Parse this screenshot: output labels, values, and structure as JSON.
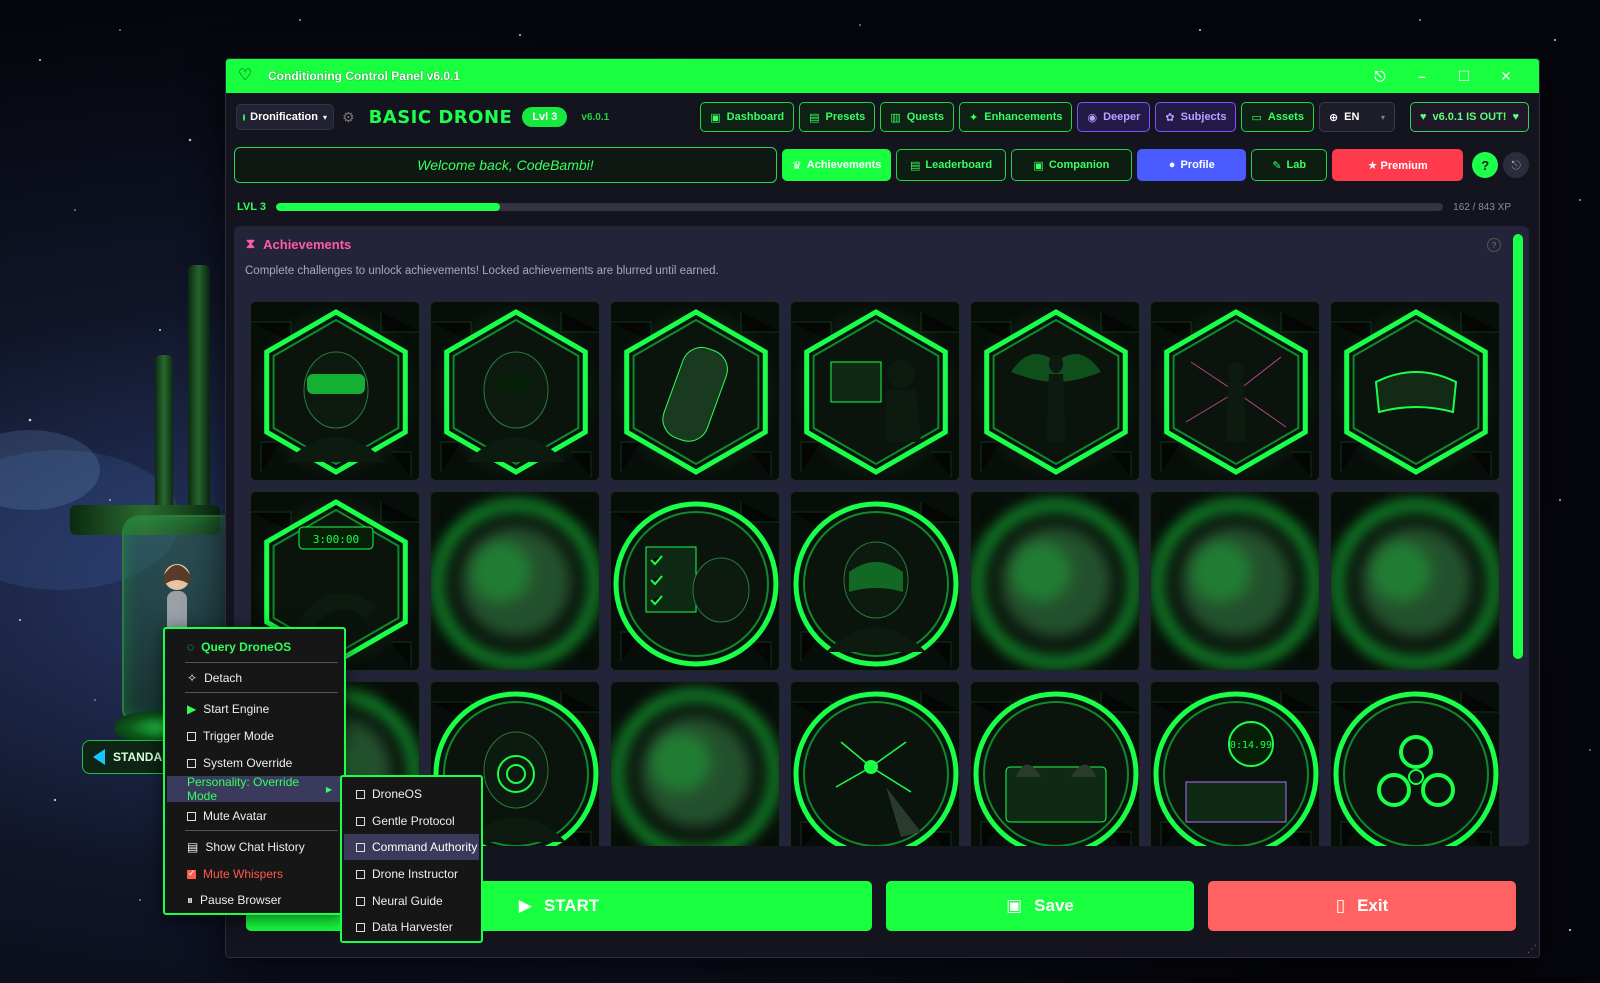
{
  "window": {
    "title": "Conditioning Control Panel v6.0.1",
    "controls": [
      "⎋",
      "–",
      "☐",
      "✕"
    ]
  },
  "toolbar": {
    "mode_value": "Dronification",
    "drone_title": "BASIC DRONE",
    "level_pill": "Lvl 3",
    "version_small": "v6.0.1",
    "nav": [
      {
        "label": "Dashboard",
        "icon": "dashboard-icon",
        "style": "green"
      },
      {
        "label": "Presets",
        "icon": "presets-icon",
        "style": "green"
      },
      {
        "label": "Quests",
        "icon": "quests-icon",
        "style": "green"
      },
      {
        "label": "Enhancements",
        "icon": "enhancements-icon",
        "style": "green"
      },
      {
        "label": "Deeper",
        "icon": "deeper-icon",
        "style": "purple"
      },
      {
        "label": "Subjects",
        "icon": "subjects-icon",
        "style": "purple"
      },
      {
        "label": "Assets",
        "icon": "folder-icon",
        "style": "green"
      }
    ],
    "language": "EN",
    "update_label": "v6.0.1 IS OUT!"
  },
  "row2": {
    "welcome": "Welcome back, CodeBambi!",
    "tabs": [
      {
        "label": "Achievements",
        "style": "active"
      },
      {
        "label": "Leaderboard",
        "style": "green"
      },
      {
        "label": "Companion",
        "style": "green"
      },
      {
        "label": "Profile",
        "style": "profile"
      },
      {
        "label": "Lab",
        "style": "green"
      },
      {
        "label": "★ Premium",
        "style": "premium"
      }
    ],
    "help": "?"
  },
  "xp": {
    "label": "LVL 3",
    "text": "162 / 843 XP",
    "progress": 0.192
  },
  "achievements": {
    "title": "Achievements",
    "subtitle": "Complete challenges to unlock achievements! Locked achievements are blurred until earned.",
    "help": "?",
    "items": [
      {
        "motif": "visor-head",
        "frame": "hex",
        "locked": false
      },
      {
        "motif": "terminal-head",
        "frame": "hex",
        "locked": false
      },
      {
        "motif": "pod-figure",
        "frame": "hex",
        "locked": false
      },
      {
        "motif": "hacker-desk",
        "frame": "hex",
        "locked": false
      },
      {
        "motif": "winged-figure",
        "frame": "hex",
        "locked": false
      },
      {
        "motif": "neural-figure",
        "frame": "hex",
        "locked": false
      },
      {
        "motif": "goggles",
        "frame": "hex",
        "locked": false
      },
      {
        "motif": "timer-figure",
        "frame": "hex",
        "locked": false
      },
      {
        "motif": "blur",
        "frame": "circle",
        "locked": true
      },
      {
        "motif": "checklist-helmet",
        "frame": "circle",
        "locked": false
      },
      {
        "motif": "helmet-face",
        "frame": "circle",
        "locked": false
      },
      {
        "motif": "blur",
        "frame": "circle",
        "locked": true
      },
      {
        "motif": "blur",
        "frame": "circle",
        "locked": true
      },
      {
        "motif": "blur",
        "frame": "circle",
        "locked": true
      },
      {
        "motif": "blur",
        "frame": "circle",
        "locked": true
      },
      {
        "motif": "spiral-head",
        "frame": "circle",
        "locked": false
      },
      {
        "motif": "blur",
        "frame": "circle",
        "locked": true
      },
      {
        "motif": "network-hand",
        "frame": "circle",
        "locked": false
      },
      {
        "motif": "keyboard-hands",
        "frame": "circle",
        "locked": false
      },
      {
        "motif": "speed-timer",
        "frame": "circle",
        "locked": false
      },
      {
        "motif": "biohazard",
        "frame": "circle",
        "locked": false
      }
    ],
    "timer_text_1": "3:00:00",
    "timer_text_2": "0:14.99"
  },
  "bottom": {
    "start": "START",
    "save": "Save",
    "exit": "Exit"
  },
  "context_menu": {
    "items": [
      {
        "label": "Query DroneOS",
        "kind": "header",
        "icon": "chat-icon"
      },
      {
        "label": "Detach",
        "kind": "normal",
        "icon": "pin-icon"
      },
      {
        "label": "Start Engine",
        "kind": "normal",
        "icon": "play-icon"
      },
      {
        "label": "Trigger Mode",
        "kind": "checkbox",
        "checked": false
      },
      {
        "label": "System Override",
        "kind": "checkbox",
        "checked": false
      },
      {
        "label": "Personality: Override Mode",
        "kind": "submenu"
      },
      {
        "label": "Mute Avatar",
        "kind": "checkbox",
        "checked": false
      },
      {
        "label": "Show Chat History",
        "kind": "normal",
        "icon": "history-icon"
      },
      {
        "label": "Mute Whispers",
        "kind": "checkbox",
        "checked": true
      },
      {
        "label": "Pause Browser",
        "kind": "normal",
        "icon": "pause-icon"
      }
    ]
  },
  "submenu": {
    "items": [
      {
        "label": "DroneOS",
        "highlight": false
      },
      {
        "label": "Gentle Protocol",
        "highlight": false
      },
      {
        "label": "Command Authority",
        "highlight": true
      },
      {
        "label": "Drone Instructor",
        "highlight": false
      },
      {
        "label": "Neural Guide",
        "highlight": false
      },
      {
        "label": "Data Harvester",
        "highlight": false
      }
    ]
  },
  "side_tab": {
    "label": "STANDAR"
  },
  "colors": {
    "accent_green": "#17ff3f",
    "purple": "#7a52ff",
    "profile_blue": "#4a5bff",
    "premium_red": "#ff3a4d",
    "exit_red": "#ff6260",
    "pink_title": "#ff5aaa"
  }
}
